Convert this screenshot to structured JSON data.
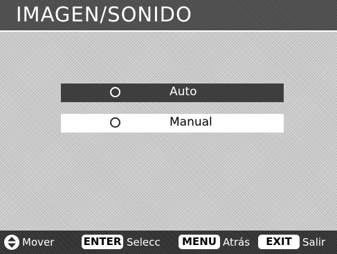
{
  "header": {
    "title": "IMAGEN/SONIDO"
  },
  "options": [
    {
      "label": "Auto",
      "selected": true
    },
    {
      "label": "Manual",
      "selected": false
    }
  ],
  "footer": {
    "move_icon": "up-down-arrows-icon",
    "move_label": "Mover",
    "enter_key": "ENTER",
    "enter_label": "Selecc",
    "menu_key": "MENU",
    "menu_label": "Atrás",
    "exit_key": "EXIT",
    "exit_label": "Salir"
  },
  "colors": {
    "highlight": "#3e3e3e",
    "background": "#c9c9c9",
    "footer": "#2f2f2f"
  }
}
